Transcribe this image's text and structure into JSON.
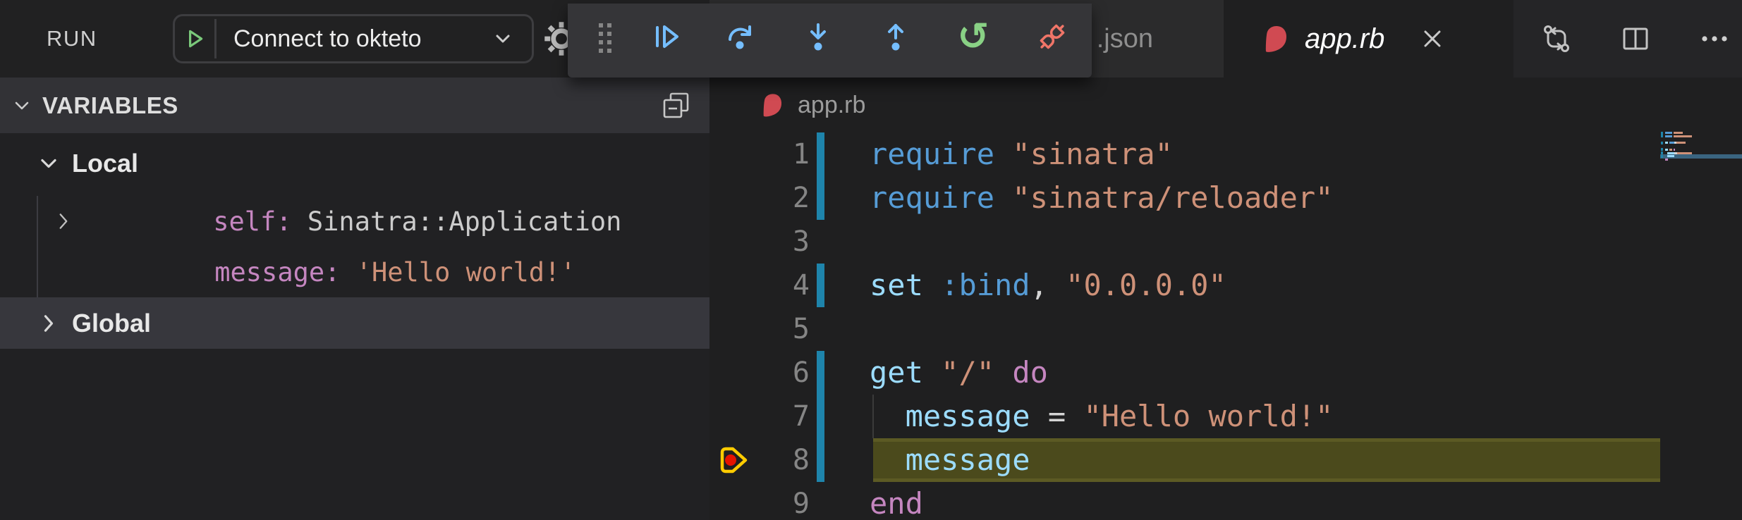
{
  "topbar": {
    "run_label": "RUN",
    "launch_button": {
      "label": "Connect to okteto"
    },
    "tabs": {
      "inactive_label": ".json",
      "active_label": "app.rb"
    }
  },
  "debug_toolbar": {
    "buttons": [
      "drag-handle",
      "continue",
      "step-over",
      "step-into",
      "step-out",
      "restart",
      "disconnect"
    ]
  },
  "sidebar": {
    "title": "VARIABLES",
    "local_label": "Local",
    "global_label": "Global",
    "variables": [
      {
        "name": "self: ",
        "value": "Sinatra::Application",
        "kind": "object"
      },
      {
        "name": "message: ",
        "value": "'Hello world!'",
        "kind": "string"
      }
    ]
  },
  "editor": {
    "breadcrumb": "app.rb",
    "current_line": 8,
    "breakpoint_line": 8,
    "lines": [
      {
        "num": "1",
        "changed": true,
        "tokens": [
          [
            "kw",
            "require"
          ],
          [
            "pl",
            " "
          ],
          [
            "str",
            "\"sinatra\""
          ]
        ]
      },
      {
        "num": "2",
        "changed": true,
        "tokens": [
          [
            "kw",
            "require"
          ],
          [
            "pl",
            " "
          ],
          [
            "str",
            "\"sinatra/reloader\""
          ]
        ]
      },
      {
        "num": "3",
        "changed": false,
        "tokens": []
      },
      {
        "num": "4",
        "changed": true,
        "tokens": [
          [
            "var",
            "set"
          ],
          [
            "pl",
            " "
          ],
          [
            "kw",
            ":bind"
          ],
          [
            "pl",
            ", "
          ],
          [
            "str",
            "\"0.0.0.0\""
          ]
        ]
      },
      {
        "num": "5",
        "changed": false,
        "tokens": []
      },
      {
        "num": "6",
        "changed": true,
        "tokens": [
          [
            "var",
            "get"
          ],
          [
            "pl",
            " "
          ],
          [
            "str",
            "\"/\""
          ],
          [
            "pl",
            " "
          ],
          [
            "kwp",
            "do"
          ]
        ]
      },
      {
        "num": "7",
        "changed": true,
        "guide": true,
        "tokens": [
          [
            "pl",
            "  "
          ],
          [
            "var",
            "message"
          ],
          [
            "pl",
            " = "
          ],
          [
            "str",
            "\"Hello world!\""
          ]
        ]
      },
      {
        "num": "8",
        "changed": true,
        "current": true,
        "breakpoint": true,
        "tokens": [
          [
            "pl",
            "  "
          ],
          [
            "var",
            "message"
          ]
        ]
      },
      {
        "num": "9",
        "changed": false,
        "tokens": [
          [
            "kwp",
            "end"
          ]
        ]
      }
    ]
  },
  "colors": {
    "keyword": "#569cd6",
    "identifier": "#9cdcfe",
    "string": "#ce9178",
    "keyword2": "#c586c0",
    "plain": "#d4d4d4",
    "change_bar": "#1e84ab",
    "current_line_bg": "#4b4a1c",
    "current_line_border": "#5c5a24",
    "minimap_highlight": "#3a6480",
    "breakpoint_red": "#e51400",
    "arrow_yellow": "#ffcc00",
    "debug_blue": "#75beff",
    "debug_green": "#89d185",
    "debug_red": "#f07568"
  }
}
